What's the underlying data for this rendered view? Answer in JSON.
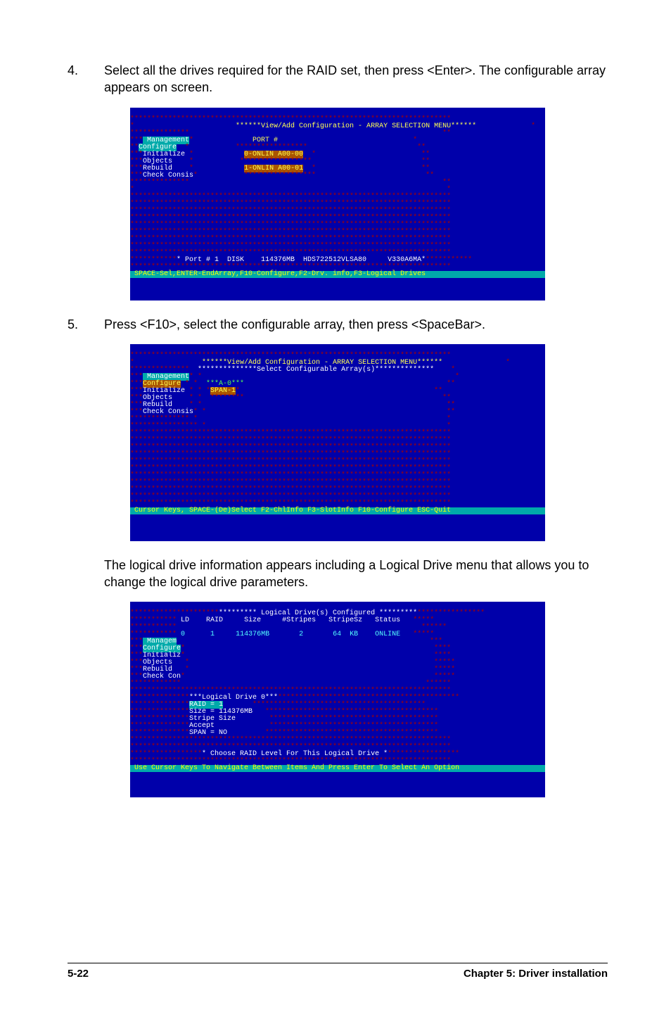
{
  "steps": {
    "step4": {
      "num": "4.",
      "text": "Select all the drives required for the RAID set, then press <Enter>. The configurable array appears on screen."
    },
    "step5": {
      "num": "5.",
      "text": "Press <F10>, select the configurable array, then press <SpaceBar>."
    },
    "postStep5a": "The logical drive information appears including a Logical Drive menu that allows you to change the logical drive parameters."
  },
  "screenshot1": {
    "title": "******View/Add Configuration - ARRAY SELECTION MENU******",
    "menu_header": " Management",
    "menu_items": [
      "Configure",
      "Initialize",
      "Objects",
      "Rebuild",
      "Check Consis"
    ],
    "port_label": "PORT #",
    "ports": [
      "0-ONLIN A00-00",
      "1-ONLIN A00-01"
    ],
    "bottom_info": "* Port # 1  DISK    114376MB  HDS722512VLSA80     V330A6MA*",
    "bottom_bar": " SPACE-Sel,ENTER-EndArray,F10-Configure,F2-Drv. info,F3-Logical Drives "
  },
  "screenshot2": {
    "title": "******View/Add Configuration - ARRAY SELECTION MENU******",
    "subtitle": "**************Select Configurable Array(s)**************",
    "menu_header": " Management",
    "menu_items": [
      "Configure",
      "Initialize",
      "Objects",
      "Rebuild",
      "Check Consis"
    ],
    "array_label": "***A-0***",
    "span_label": "SPAN-1",
    "bottom_bar": " Cursor Keys, SPACE-(De)Select F2-ChlInfo F3-SlotInfo F10-Configure ESC-Quit "
  },
  "screenshot3": {
    "header": "********* Logical Drive(s) Configured *********",
    "columns": [
      "LD",
      "RAID",
      "Size",
      "#Stripes",
      "StripeSz",
      "Status"
    ],
    "row": {
      "ld": "0",
      "raid": "1",
      "size": "114376MB",
      "stripes": "2",
      "stripesz": "64  KB",
      "status": "ONLINE"
    },
    "menu_header": " Managem",
    "menu_items": [
      "Configure",
      "Initializ",
      "Objects",
      "Rebuild",
      "Check Con"
    ],
    "ld_box_title": "***Logical Drive 0***",
    "ld_box_items": [
      "RAID = 1",
      "Size = 114376MB",
      "Stripe Size",
      "Accept",
      "SPAN = NO"
    ],
    "prompt": "* Choose RAID Level For This Logical Drive *",
    "bottom_bar": " Use Cursor Keys To Navigate Between Items And Press Enter To Select An Option "
  },
  "footer": {
    "left": "5-22",
    "right": "Chapter 5: Driver installation"
  }
}
